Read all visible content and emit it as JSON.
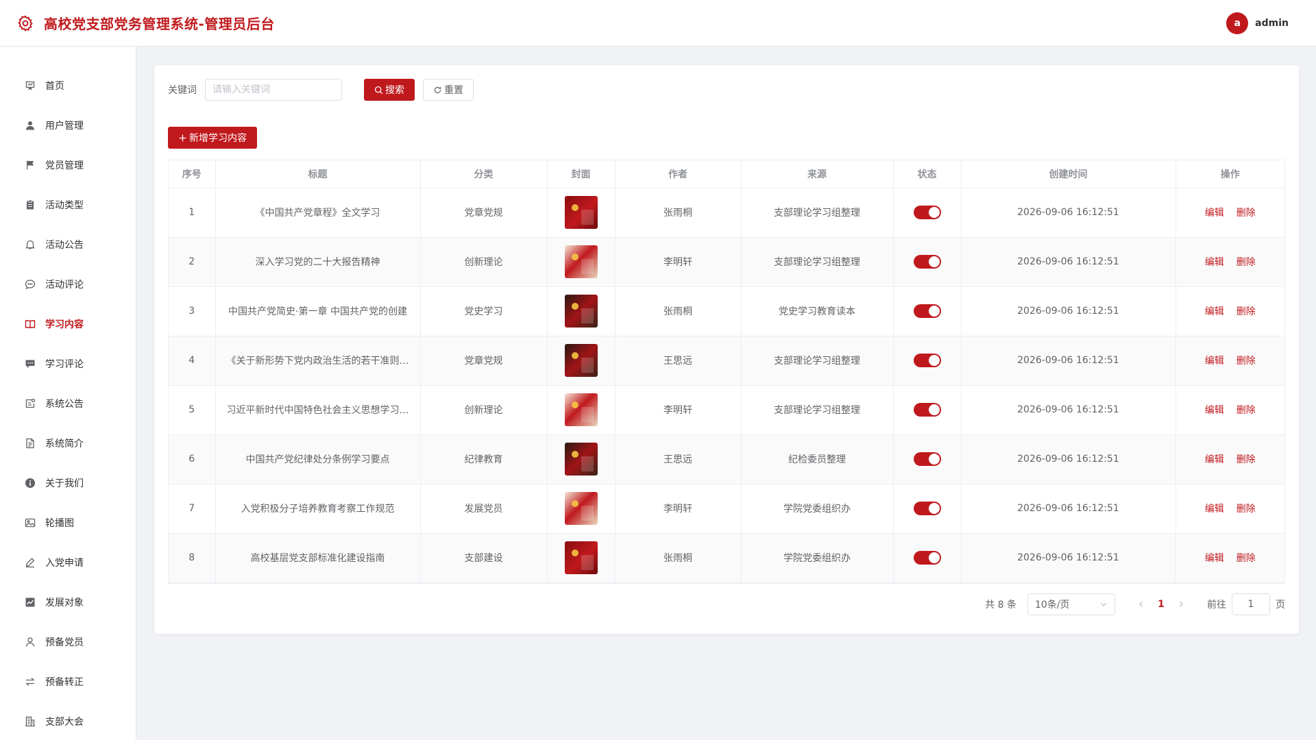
{
  "header": {
    "title": "高校党支部党务管理系统-管理员后台",
    "user": {
      "avatar_letter": "a",
      "name": "admin"
    }
  },
  "sidebar": {
    "items": [
      {
        "label": "首页",
        "icon": "presentation-icon",
        "active": false
      },
      {
        "label": "用户管理",
        "icon": "user-icon",
        "active": false
      },
      {
        "label": "党员管理",
        "icon": "flag-icon",
        "active": false
      },
      {
        "label": "活动类型",
        "icon": "clipboard-icon",
        "active": false
      },
      {
        "label": "活动公告",
        "icon": "bell-icon",
        "active": false
      },
      {
        "label": "活动评论",
        "icon": "chat-bubble-icon",
        "active": false
      },
      {
        "label": "学习内容",
        "icon": "open-book-icon",
        "active": true
      },
      {
        "label": "学习评论",
        "icon": "comment-icon",
        "active": false
      },
      {
        "label": "系统公告",
        "icon": "notice-icon",
        "active": false
      },
      {
        "label": "系统简介",
        "icon": "document-icon",
        "active": false
      },
      {
        "label": "关于我们",
        "icon": "info-icon",
        "active": false
      },
      {
        "label": "轮播图",
        "icon": "picture-icon",
        "active": false
      },
      {
        "label": "入党申请",
        "icon": "pen-icon",
        "active": false
      },
      {
        "label": "发展对象",
        "icon": "trend-icon",
        "active": false
      },
      {
        "label": "预备党员",
        "icon": "person-outline-icon",
        "active": false
      },
      {
        "label": "预备转正",
        "icon": "switch-arrows-icon",
        "active": false
      },
      {
        "label": "支部大会",
        "icon": "building-icon",
        "active": false
      }
    ]
  },
  "search": {
    "label": "关键词",
    "placeholder": "请输入关键词",
    "value": "",
    "search_button": "搜索",
    "reset_button": "重置"
  },
  "toolbar": {
    "add_button": "新增学习内容"
  },
  "table": {
    "columns": [
      "序号",
      "标题",
      "分类",
      "封面",
      "作者",
      "来源",
      "状态",
      "创建时间",
      "操作"
    ],
    "edit_label": "编辑",
    "delete_label": "删除",
    "rows": [
      {
        "no": "1",
        "title": "《中国共产党章程》全文学习",
        "category": "党章党规",
        "cover_style": "red",
        "author": "张雨桐",
        "source": "支部理论学习组整理",
        "status": true,
        "created": "2026-09-06 16:12:51"
      },
      {
        "no": "2",
        "title": "深入学习党的二十大报告精神",
        "category": "创新理论",
        "cover_style": "light",
        "author": "李明轩",
        "source": "支部理论学习组整理",
        "status": true,
        "created": "2026-09-06 16:12:51"
      },
      {
        "no": "3",
        "title": "中国共产党简史·第一章 中国共产党的创建",
        "category": "党史学习",
        "cover_style": "dark",
        "author": "张雨桐",
        "source": "党史学习教育读本",
        "status": true,
        "created": "2026-09-06 16:12:51"
      },
      {
        "no": "4",
        "title": "《关于新形势下党内政治生活的若干准则…",
        "category": "党章党规",
        "cover_style": "dark",
        "author": "王思远",
        "source": "支部理论学习组整理",
        "status": true,
        "created": "2026-09-06 16:12:51"
      },
      {
        "no": "5",
        "title": "习近平新时代中国特色社会主义思想学习…",
        "category": "创新理论",
        "cover_style": "light",
        "author": "李明轩",
        "source": "支部理论学习组整理",
        "status": true,
        "created": "2026-09-06 16:12:51"
      },
      {
        "no": "6",
        "title": "中国共产党纪律处分条例学习要点",
        "category": "纪律教育",
        "cover_style": "dark",
        "author": "王思远",
        "source": "纪检委员整理",
        "status": true,
        "created": "2026-09-06 16:12:51"
      },
      {
        "no": "7",
        "title": "入党积极分子培养教育考察工作规范",
        "category": "发展党员",
        "cover_style": "light",
        "author": "李明轩",
        "source": "学院党委组织办",
        "status": true,
        "created": "2026-09-06 16:12:51"
      },
      {
        "no": "8",
        "title": "高校基层党支部标准化建设指南",
        "category": "支部建设",
        "cover_style": "red",
        "author": "张雨桐",
        "source": "学院党委组织办",
        "status": true,
        "created": "2026-09-06 16:12:51"
      }
    ]
  },
  "pagination": {
    "total_text": "共 8 条",
    "page_size": "10条/页",
    "current_page": "1",
    "goto_label": "前往",
    "goto_value": "1",
    "page_unit": "页"
  },
  "colors": {
    "primary": "#c0191d"
  }
}
